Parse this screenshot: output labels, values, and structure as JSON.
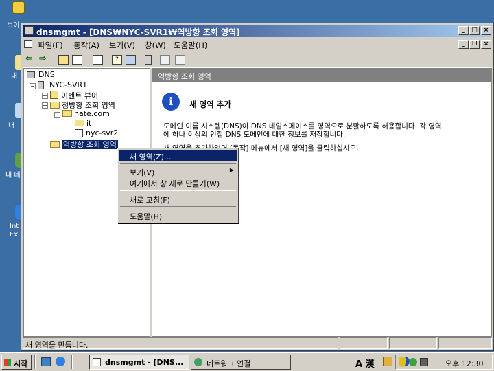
{
  "desktop": {
    "icons": [
      {
        "label": "보이"
      },
      {
        "label": "내"
      },
      {
        "label": "내 "
      },
      {
        "label": "내 네"
      },
      {
        "label": "Int Ex"
      }
    ]
  },
  "window": {
    "title": "dnsmgmt - [DNS₩NYC-SVR1₩역방향 조회 영역]",
    "controls": {
      "min": "_",
      "max": "□",
      "close": "×"
    }
  },
  "menubar": {
    "items": [
      {
        "label": "파일(F)"
      },
      {
        "label": "동작(A)"
      },
      {
        "label": "보기(V)"
      },
      {
        "label": "창(W)"
      },
      {
        "label": "도움말(H)"
      }
    ]
  },
  "toolbar": {
    "buttons": [
      "back-icon",
      "forward-icon",
      "up-folder-icon",
      "show-tree-icon",
      "export-icon",
      "help-icon",
      "console-icon",
      "server-icon",
      "list-icon",
      "details-icon"
    ]
  },
  "tree": {
    "root": "DNS",
    "server": "NYC-SVR1",
    "event_viewer": "이벤트 뷰어",
    "forward_zones": "정방향 조회 영역",
    "zone": "nate.com",
    "subfolder": "it",
    "host": "nyc-svr2",
    "reverse_zones": "역방향 조회 영역"
  },
  "right_pane": {
    "header": "역방향 조회 영역",
    "info_title": "새 영역 추가",
    "paragraph1_line1": "도메인 이름 시스템(DNS)이 DNS 네임스페이스를 영역으로 분할하도록 허용합니다. 각 영역",
    "paragraph1_line2": "에 하나 이상의 인접 DNS 도메인에 대한 정보를 저장합니다.",
    "paragraph2": "새 영역을 추가하려면 [동작] 메뉴에서 [새 영역]을 클릭하십시오."
  },
  "context_menu": {
    "items": [
      {
        "label": "새 영역(Z)...",
        "selected": true
      },
      {
        "label": "보기(V)",
        "submenu": true
      },
      {
        "label": "여기에서 창 새로 만들기(W)"
      },
      {
        "label": "새로 고침(F)"
      },
      {
        "label": "도움말(H)"
      }
    ]
  },
  "statusbar": {
    "text": "새 영역을 만듭니다."
  },
  "taskbar": {
    "start": "시작",
    "tasks": [
      {
        "label": "dnsmgmt - [DNS...",
        "active": true
      },
      {
        "label": "네트워크 연결",
        "active": false
      }
    ],
    "ime": "A 漢",
    "clock": "오후 12:30"
  },
  "colors": {
    "desktop": "#3a6ea5",
    "titlebar_start": "#0a246a",
    "titlebar_end": "#a6caf0",
    "selection": "#0a246a",
    "face": "#d4d0c8"
  }
}
